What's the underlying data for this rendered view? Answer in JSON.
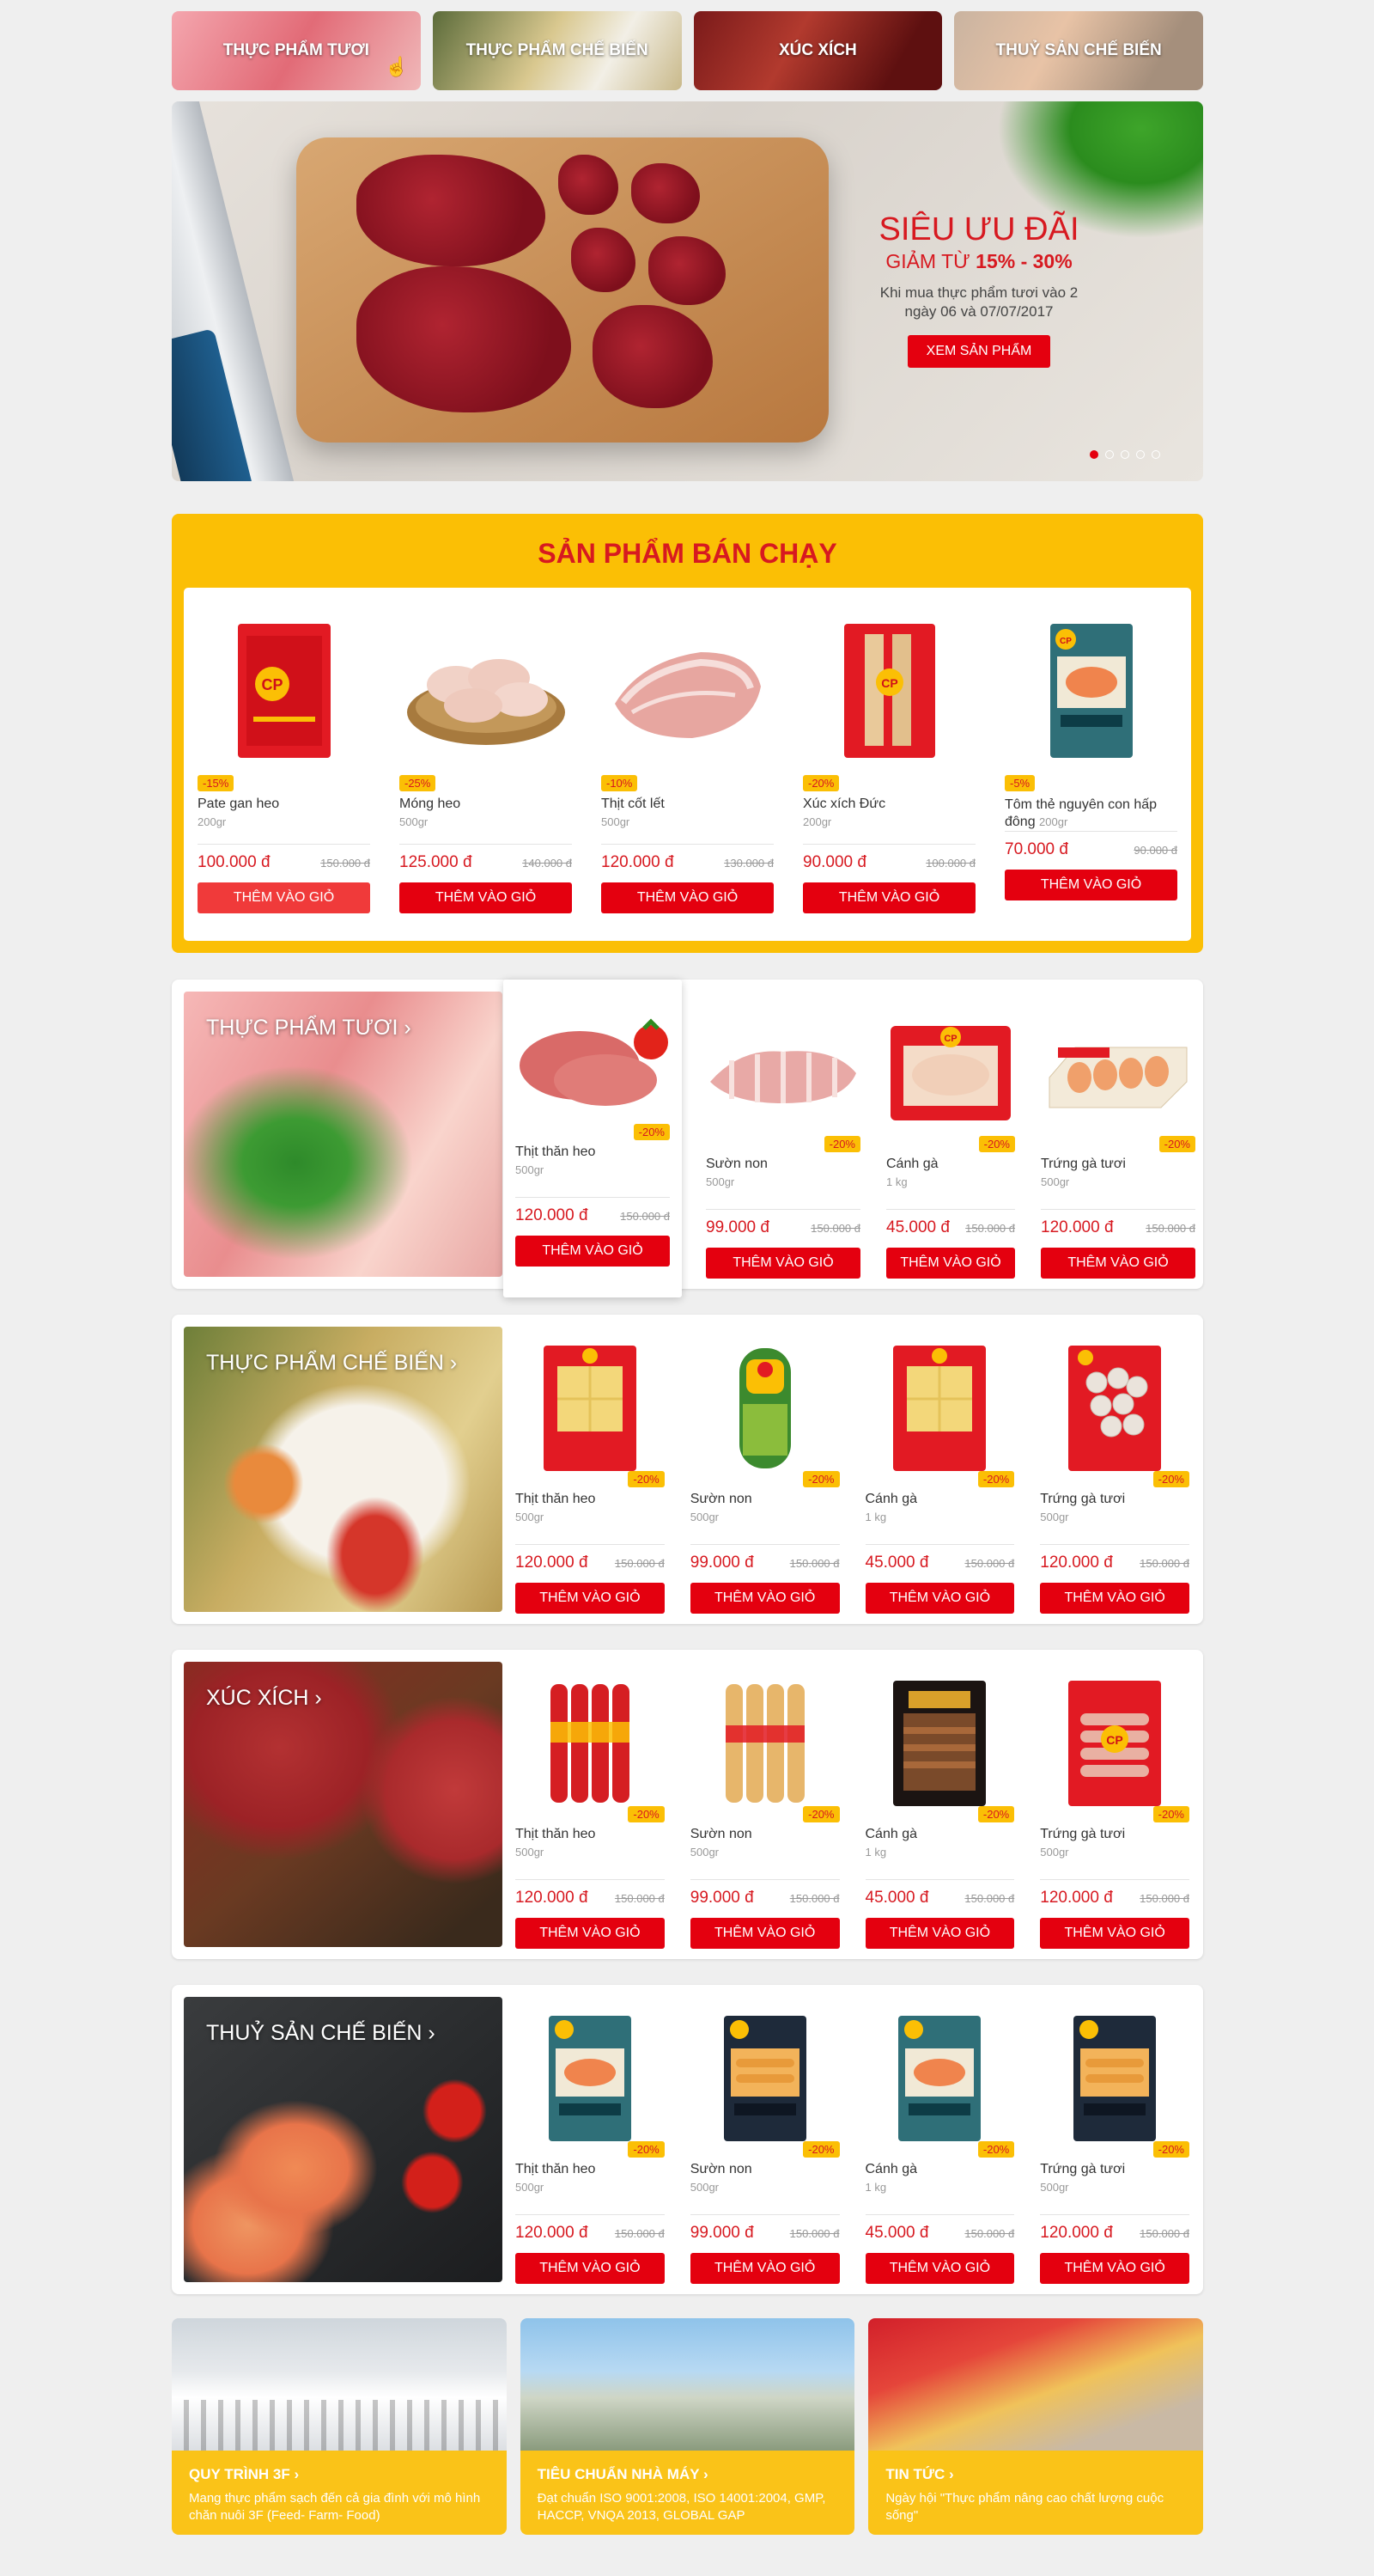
{
  "categories": [
    "THỰC PHẨM TƯƠI",
    "THỰC PHẨM CHẾ BIẾN",
    "XÚC XÍCH",
    "THUỶ SẢN CHẾ BIẾN"
  ],
  "hero": {
    "line1": "SIÊU ƯU ĐÃI",
    "line2_prefix": "GIẢM TỪ ",
    "line2_bold": "15% - 30%",
    "line3": "Khi mua thực phẩm tươi vào 2 ngày 06 và 07/07/2017",
    "button": "XEM SẢN PHẨM"
  },
  "bestsellers": {
    "title": "SẢN PHẨM BÁN CHẠY",
    "items": [
      {
        "discount": "-15%",
        "name": "Pate gan heo",
        "weight": "200gr",
        "price": "100.000 đ",
        "old": "150.000 đ",
        "button": "THÊM VÀO GIỎ"
      },
      {
        "discount": "-25%",
        "name": "Móng heo",
        "weight": "500gr",
        "price": "125.000 đ",
        "old": "140.000 đ",
        "button": "THÊM VÀO GIỎ"
      },
      {
        "discount": "-10%",
        "name": "Thịt cốt lết",
        "weight": "500gr",
        "price": "120.000 đ",
        "old": "130.000 đ",
        "button": "THÊM VÀO GIỎ"
      },
      {
        "discount": "-20%",
        "name": "Xúc xích Đức",
        "weight": "200gr",
        "price": "90.000 đ",
        "old": "100.000 đ",
        "button": "THÊM VÀO GIỎ"
      },
      {
        "discount": "-5%",
        "name": "Tôm thẻ nguyên con hấp đông",
        "weight": "200gr",
        "price": "70.000 đ",
        "old": "90.000 đ",
        "button": "THÊM VÀO GIỎ"
      }
    ]
  },
  "rows": [
    {
      "title": "THỰC PHẨM TƯƠI",
      "items": [
        {
          "discount": "-20%",
          "name": "Thịt thăn heo",
          "weight": "500gr",
          "price": "120.000 đ",
          "old": "150.000 đ",
          "button": "THÊM VÀO GIỎ"
        },
        {
          "discount": "-20%",
          "name": "Sườn non",
          "weight": "500gr",
          "price": "99.000 đ",
          "old": "150.000 đ",
          "button": "THÊM VÀO GIỎ"
        },
        {
          "discount": "-20%",
          "name": "Cánh gà",
          "weight": "1 kg",
          "price": "45.000 đ",
          "old": "150.000 đ",
          "button": "THÊM VÀO GIỎ"
        },
        {
          "discount": "-20%",
          "name": "Trứng gà tươi",
          "weight": "500gr",
          "price": "120.000 đ",
          "old": "150.000 đ",
          "button": "THÊM VÀO GIỎ"
        }
      ]
    },
    {
      "title": "THỰC PHẨM CHẾ BIẾN",
      "items": [
        {
          "discount": "-20%",
          "name": "Thịt thăn heo",
          "weight": "500gr",
          "price": "120.000 đ",
          "old": "150.000 đ",
          "button": "THÊM VÀO GIỎ"
        },
        {
          "discount": "-20%",
          "name": "Sườn non",
          "weight": "500gr",
          "price": "99.000 đ",
          "old": "150.000 đ",
          "button": "THÊM VÀO GIỎ"
        },
        {
          "discount": "-20%",
          "name": "Cánh gà",
          "weight": "1 kg",
          "price": "45.000 đ",
          "old": "150.000 đ",
          "button": "THÊM VÀO GIỎ"
        },
        {
          "discount": "-20%",
          "name": "Trứng gà tươi",
          "weight": "500gr",
          "price": "120.000 đ",
          "old": "150.000 đ",
          "button": "THÊM VÀO GIỎ"
        }
      ]
    },
    {
      "title": "XÚC XÍCH",
      "items": [
        {
          "discount": "-20%",
          "name": "Thịt thăn heo",
          "weight": "500gr",
          "price": "120.000 đ",
          "old": "150.000 đ",
          "button": "THÊM VÀO GIỎ"
        },
        {
          "discount": "-20%",
          "name": "Sườn non",
          "weight": "500gr",
          "price": "99.000 đ",
          "old": "150.000 đ",
          "button": "THÊM VÀO GIỎ"
        },
        {
          "discount": "-20%",
          "name": "Cánh gà",
          "weight": "1 kg",
          "price": "45.000 đ",
          "old": "150.000 đ",
          "button": "THÊM VÀO GIỎ"
        },
        {
          "discount": "-20%",
          "name": "Trứng gà tươi",
          "weight": "500gr",
          "price": "120.000 đ",
          "old": "150.000 đ",
          "button": "THÊM VÀO GIỎ"
        }
      ]
    },
    {
      "title": "THUỶ SẢN CHẾ BIẾN",
      "items": [
        {
          "discount": "-20%",
          "name": "Thịt thăn heo",
          "weight": "500gr",
          "price": "120.000 đ",
          "old": "150.000 đ",
          "button": "THÊM VÀO GIỎ"
        },
        {
          "discount": "-20%",
          "name": "Sườn non",
          "weight": "500gr",
          "price": "99.000 đ",
          "old": "150.000 đ",
          "button": "THÊM VÀO GIỎ"
        },
        {
          "discount": "-20%",
          "name": "Cánh gà",
          "weight": "1 kg",
          "price": "45.000 đ",
          "old": "150.000 đ",
          "button": "THÊM VÀO GIỎ"
        },
        {
          "discount": "-20%",
          "name": "Trứng gà tươi",
          "weight": "500gr",
          "price": "120.000 đ",
          "old": "150.000 đ",
          "button": "THÊM VÀO GIỎ"
        }
      ]
    }
  ],
  "info": [
    {
      "title": "QUY TRÌNH 3F",
      "text": "Mang thực phẩm sạch đến cả gia đình với mô hình chăn nuôi 3F (Feed- Farm- Food)"
    },
    {
      "title": "TIÊU CHUẨN NHÀ MÁY",
      "text": "Đạt chuẩn ISO 9001:2008, ISO 14001:2004, GMP, HACCP, VNQA 2013, GLOBAL GAP"
    },
    {
      "title": "TIN TỨC",
      "text": "Ngày hội \"Thực phẩm nâng cao chất lượng cuộc sống\""
    }
  ],
  "colors": {
    "red": "#e4000f",
    "yellow": "#fbbf05",
    "price": "#d71920"
  }
}
